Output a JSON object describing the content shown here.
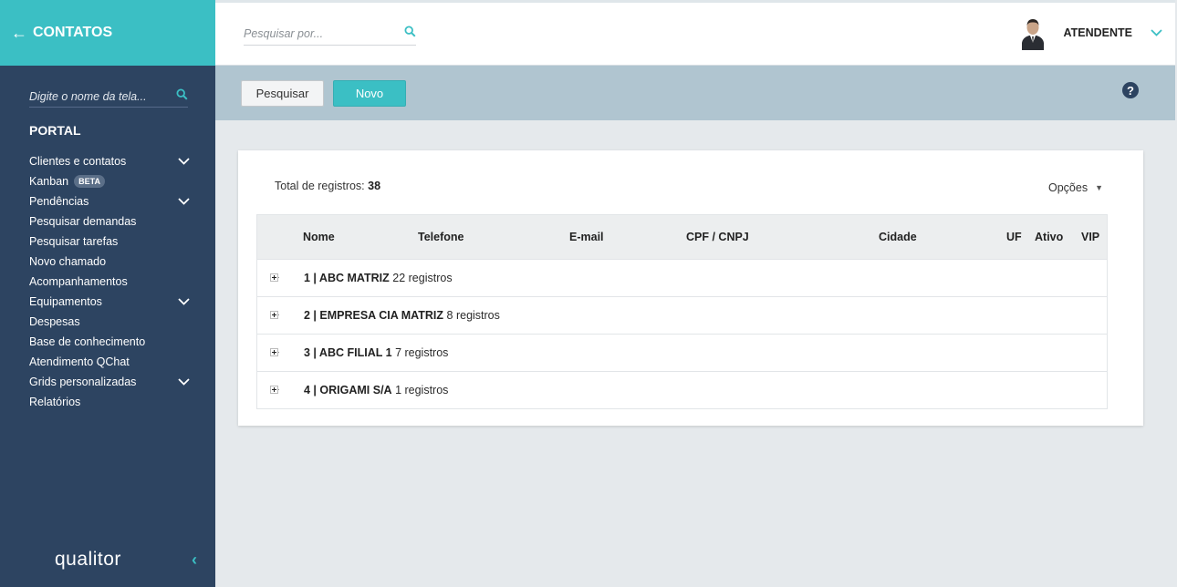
{
  "sidebar": {
    "title": "CONTATOS",
    "search_placeholder": "Digite o nome da tela...",
    "section": "PORTAL",
    "items": [
      {
        "label": "Clientes e contatos",
        "expandable": true
      },
      {
        "label": "Kanban",
        "badge": "BETA"
      },
      {
        "label": "Pendências",
        "expandable": true
      },
      {
        "label": "Pesquisar demandas"
      },
      {
        "label": "Pesquisar tarefas"
      },
      {
        "label": "Novo chamado"
      },
      {
        "label": "Acompanhamentos"
      },
      {
        "label": "Equipamentos",
        "expandable": true
      },
      {
        "label": "Despesas"
      },
      {
        "label": "Base de conhecimento"
      },
      {
        "label": "Atendimento QChat"
      },
      {
        "label": "Grids personalizadas",
        "expandable": true
      },
      {
        "label": "Relatórios"
      }
    ],
    "logo": "qualitor"
  },
  "header": {
    "search_placeholder": "Pesquisar por...",
    "user": "ATENDENTE"
  },
  "toolbar": {
    "search_label": "Pesquisar",
    "new_label": "Novo",
    "help": "?"
  },
  "main": {
    "total_label": "Total de registros:",
    "total_value": "38",
    "options_label": "Opções",
    "columns": [
      "Nome",
      "Telefone",
      "E-mail",
      "CPF / CNPJ",
      "Cidade",
      "UF",
      "Ativo",
      "VIP"
    ],
    "groups": [
      {
        "name": "1 | ABC MATRIZ",
        "count": "22 registros"
      },
      {
        "name": "2 | EMPRESA CIA MATRIZ",
        "count": "8 registros"
      },
      {
        "name": "3 | ABC FILIAL 1",
        "count": "7 registros"
      },
      {
        "name": "4 | ORIGAMI S/A",
        "count": "1 registros"
      }
    ]
  },
  "colors": {
    "accent": "#3bbfc4",
    "sidebar": "#2d4461",
    "toolbar": "#b0c5d0",
    "background": "#e5e9ec"
  }
}
